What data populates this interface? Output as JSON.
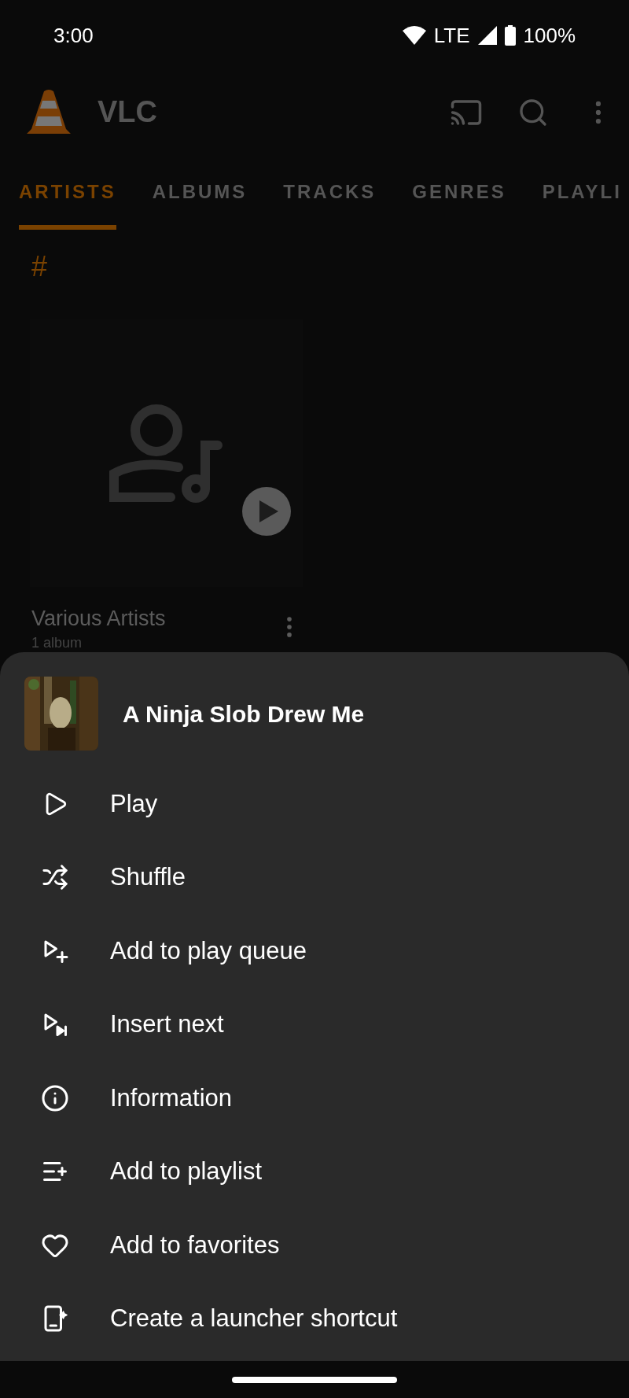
{
  "status_bar": {
    "time": "3:00",
    "network": "LTE",
    "battery": "100%"
  },
  "app_bar": {
    "title": "VLC"
  },
  "tabs": [
    {
      "label": "ARTISTS",
      "selected": true
    },
    {
      "label": "ALBUMS",
      "selected": false
    },
    {
      "label": "TRACKS",
      "selected": false
    },
    {
      "label": "GENRES",
      "selected": false
    },
    {
      "label": "PLAYLI",
      "selected": false
    }
  ],
  "section_header": "#",
  "artist_card": {
    "name": "Various Artists",
    "subtitle": "1 album"
  },
  "sheet": {
    "title": "A Ninja Slob Drew Me",
    "items": [
      {
        "label": "Play"
      },
      {
        "label": "Shuffle"
      },
      {
        "label": "Add to play queue"
      },
      {
        "label": "Insert next"
      },
      {
        "label": "Information"
      },
      {
        "label": "Add to playlist"
      },
      {
        "label": "Add to favorites"
      },
      {
        "label": "Create a launcher shortcut"
      }
    ]
  }
}
